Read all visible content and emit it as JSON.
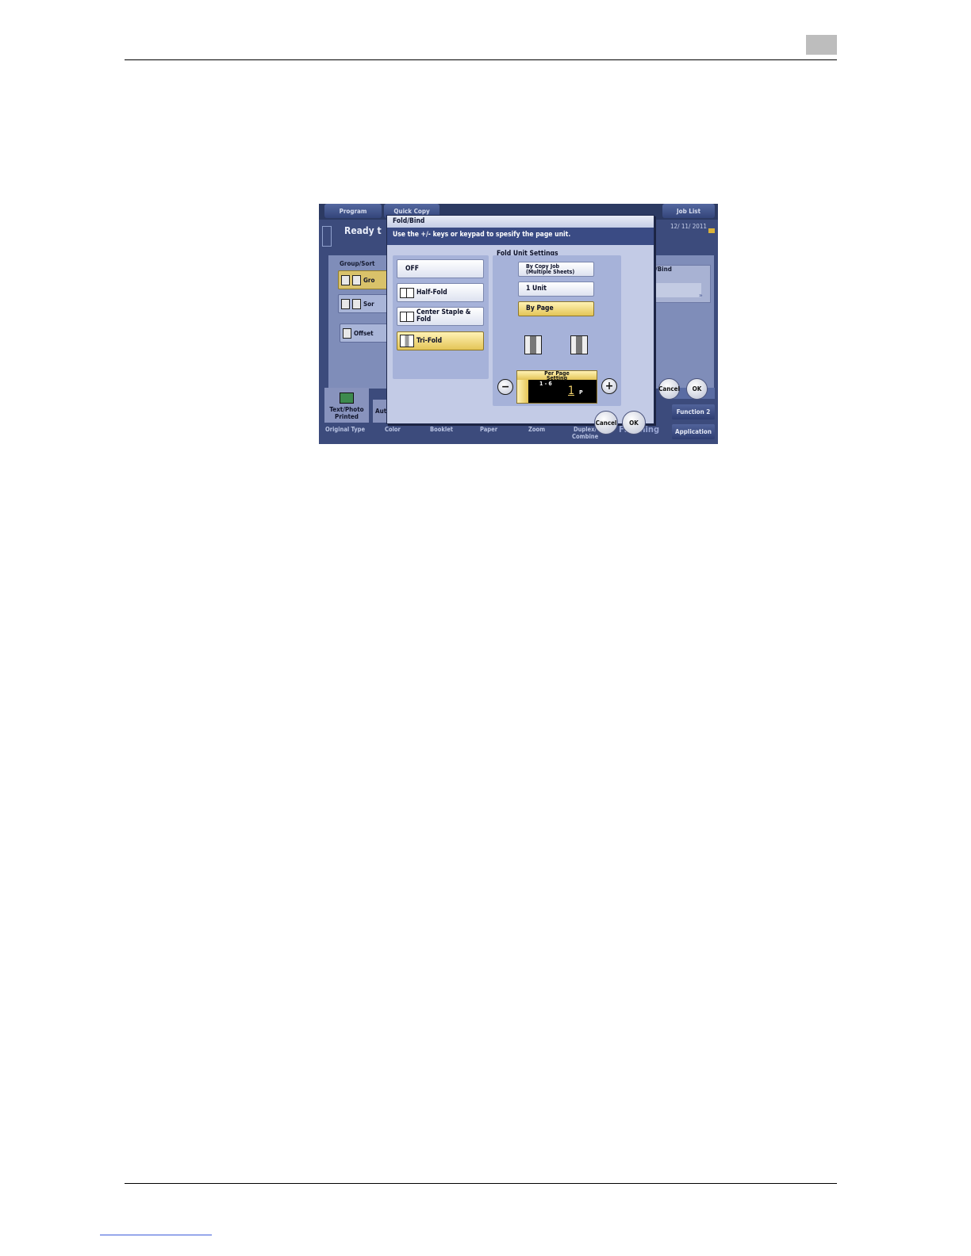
{
  "background": {
    "top_tabs": {
      "program": "Program",
      "quick_copy": "Quick Copy",
      "job_list": "Job List"
    },
    "status_title": "Ready t",
    "date": "12/ 11/ 2011",
    "group_sort_label": "Group/Sort",
    "group_label": "Gro",
    "sort_label": "Sor",
    "offset_label": "Offset",
    "fold_bind_label": "/Bind",
    "original_type_button": {
      "line1": "Text/Photo",
      "line2": "Printed"
    },
    "color_button_label": "Aut",
    "bottom_labels": [
      "Original Type",
      "Color",
      "Booklet",
      "Paper",
      "Zoom",
      "Duplex/",
      "Combine"
    ],
    "finishing_label": "Finishing",
    "function2": "Function 2",
    "application": "Application",
    "cancel": "Cancel",
    "ok": "OK"
  },
  "dialog": {
    "title": "Fold/Bind",
    "message": "Use the +/- keys or keypad to spesify the page unit.",
    "options": [
      {
        "label": "OFF",
        "icon": null,
        "selected": false
      },
      {
        "label": "Half-Fold",
        "icon": "half-fold-icon",
        "selected": false
      },
      {
        "label_line1": "Center Staple &",
        "label_line2": "Fold",
        "icon": "center-staple-fold-icon",
        "selected": false
      },
      {
        "label": "Tri-Fold",
        "icon": "tri-fold-icon",
        "selected": true
      }
    ],
    "fold_unit": {
      "title": "Fold Unit Settings",
      "by_copy_job_line1": "By Copy Job",
      "by_copy_job_line2": "(Multiple Sheets)",
      "one_unit": "1 Unit",
      "by_page": "By Page",
      "selected": "By Page"
    },
    "per_page": {
      "title_line1": "Per Page",
      "title_line2": "Setting",
      "range": "1 - 6",
      "value": "1",
      "unit": "P"
    },
    "cancel": "Cancel",
    "ok": "OK"
  },
  "colors": {
    "accent_yellow": "#e4c557",
    "screen_navy": "#2c3a62",
    "dialog_bg": "#c3cbe6"
  }
}
